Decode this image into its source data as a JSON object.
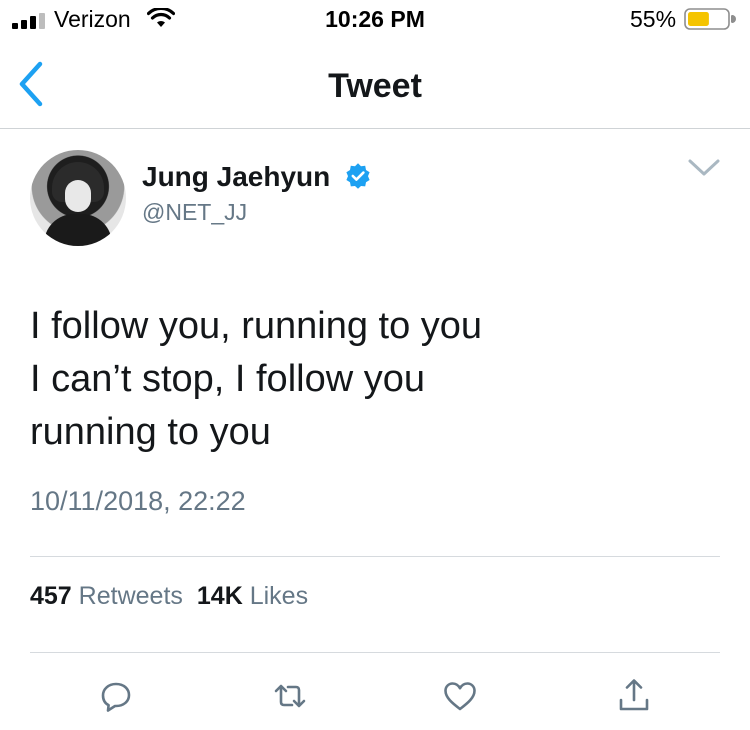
{
  "status_bar": {
    "carrier": "Verizon",
    "time": "10:26 PM",
    "battery_percent": "55%",
    "battery_level": 0.55,
    "battery_color": "#f5c400"
  },
  "nav": {
    "title": "Tweet",
    "back_icon": "chevron-left-icon",
    "accent_color": "#1da1f2"
  },
  "tweet": {
    "author": {
      "name": "Jung Jaehyun",
      "handle": "@NET_JJ",
      "verified": true,
      "verified_color": "#1da1f2"
    },
    "text_lines": [
      "I follow you, running to you",
      "I can’t stop, I follow you",
      "running to you"
    ],
    "timestamp": "10/11/2018, 22:22",
    "stats": {
      "retweets_count": "457",
      "retweets_label": "Retweets",
      "likes_count": "14K",
      "likes_label": "Likes"
    },
    "actions": [
      "reply-icon",
      "retweet-icon",
      "like-icon",
      "share-icon"
    ]
  }
}
